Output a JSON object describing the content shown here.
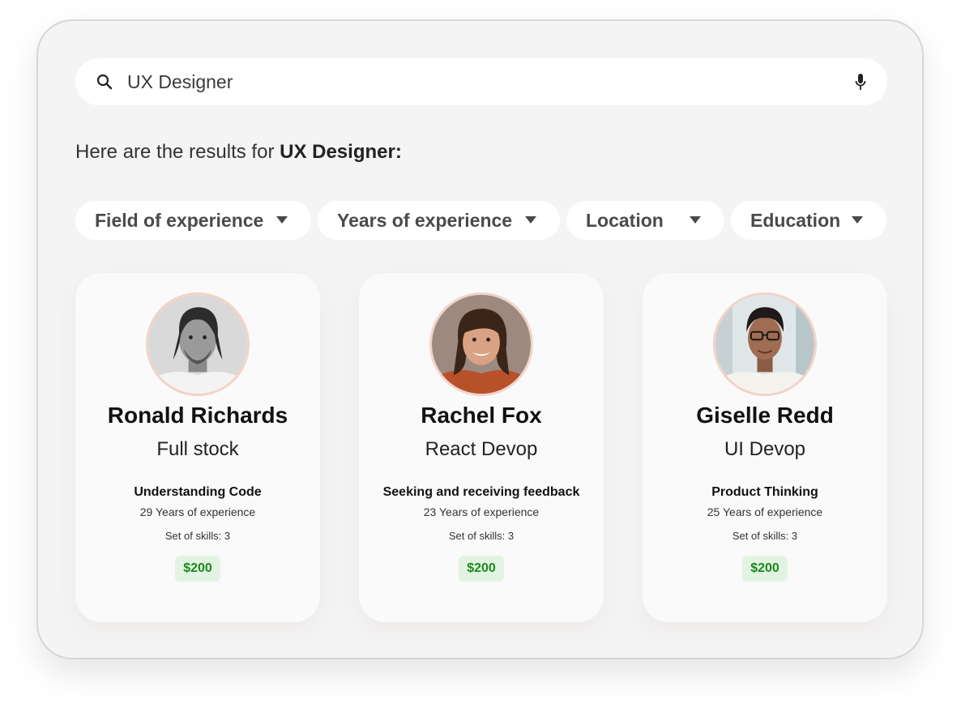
{
  "search": {
    "query": "UX Designer",
    "icon": "search-icon",
    "voice_icon": "microphone-icon"
  },
  "results": {
    "prefix": "Here are the results for ",
    "term": "UX Designer:"
  },
  "filters": [
    {
      "label": "Field of experience",
      "icon": "caret-down-icon"
    },
    {
      "label": "Years of experience",
      "icon": "caret-down-icon"
    },
    {
      "label": "Location",
      "icon": "caret-down-icon"
    },
    {
      "label": "Education",
      "icon": "caret-down-icon"
    }
  ],
  "cards": [
    {
      "name": "Ronald Richards",
      "role": "Full stock",
      "skill": "Understanding Code",
      "years": "29  Years of experience",
      "skills": "Set of skills: 3",
      "price": "$200",
      "avatar": "avatar-man-grayscale"
    },
    {
      "name": "Rachel Fox",
      "role": "React Devop",
      "skill": "Seeking and receiving feedback",
      "years": "23  Years of experience",
      "skills": "Set of skills: 3",
      "price": "$200",
      "avatar": "avatar-woman-smiling"
    },
    {
      "name": "Giselle Redd",
      "role": "UI Devop",
      "skill": "Product Thinking",
      "years": "25  Years of experience",
      "skills": "Set of skills: 3",
      "price": "$200",
      "avatar": "avatar-woman-glasses"
    }
  ],
  "colors": {
    "background": "#f4f4f4",
    "card": "#fafafa",
    "price_bg": "#e3f3e3",
    "price_text": "#1a8a1a",
    "avatar_ring": "#f2d3c8"
  }
}
